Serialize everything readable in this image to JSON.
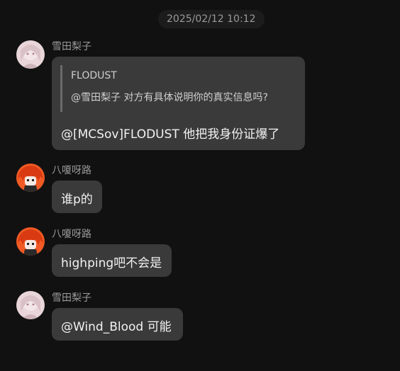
{
  "timestamp": "2025/02/12 10:12",
  "messages": [
    {
      "sender": "雪田梨子",
      "avatar": "pink-girl-avatar",
      "quote": {
        "author": "FLODUST",
        "text": "@雪田梨子 对方有具体说明你的真实信息吗?"
      },
      "text": "@[MCSov]FLODUST 他把我身份证爆了"
    },
    {
      "sender": "八嗄呀路",
      "avatar": "red-hair-avatar",
      "text": "谁p的"
    },
    {
      "sender": "八嗄呀路",
      "avatar": "red-hair-avatar",
      "text": "highping吧不会是"
    },
    {
      "sender": "雪田梨子",
      "avatar": "pink-girl-avatar",
      "text": "@Wind_Blood 可能"
    }
  ],
  "colors": {
    "background": "#111111",
    "bubble": "#3a3a3a",
    "sender_text": "#9b9b9b"
  }
}
